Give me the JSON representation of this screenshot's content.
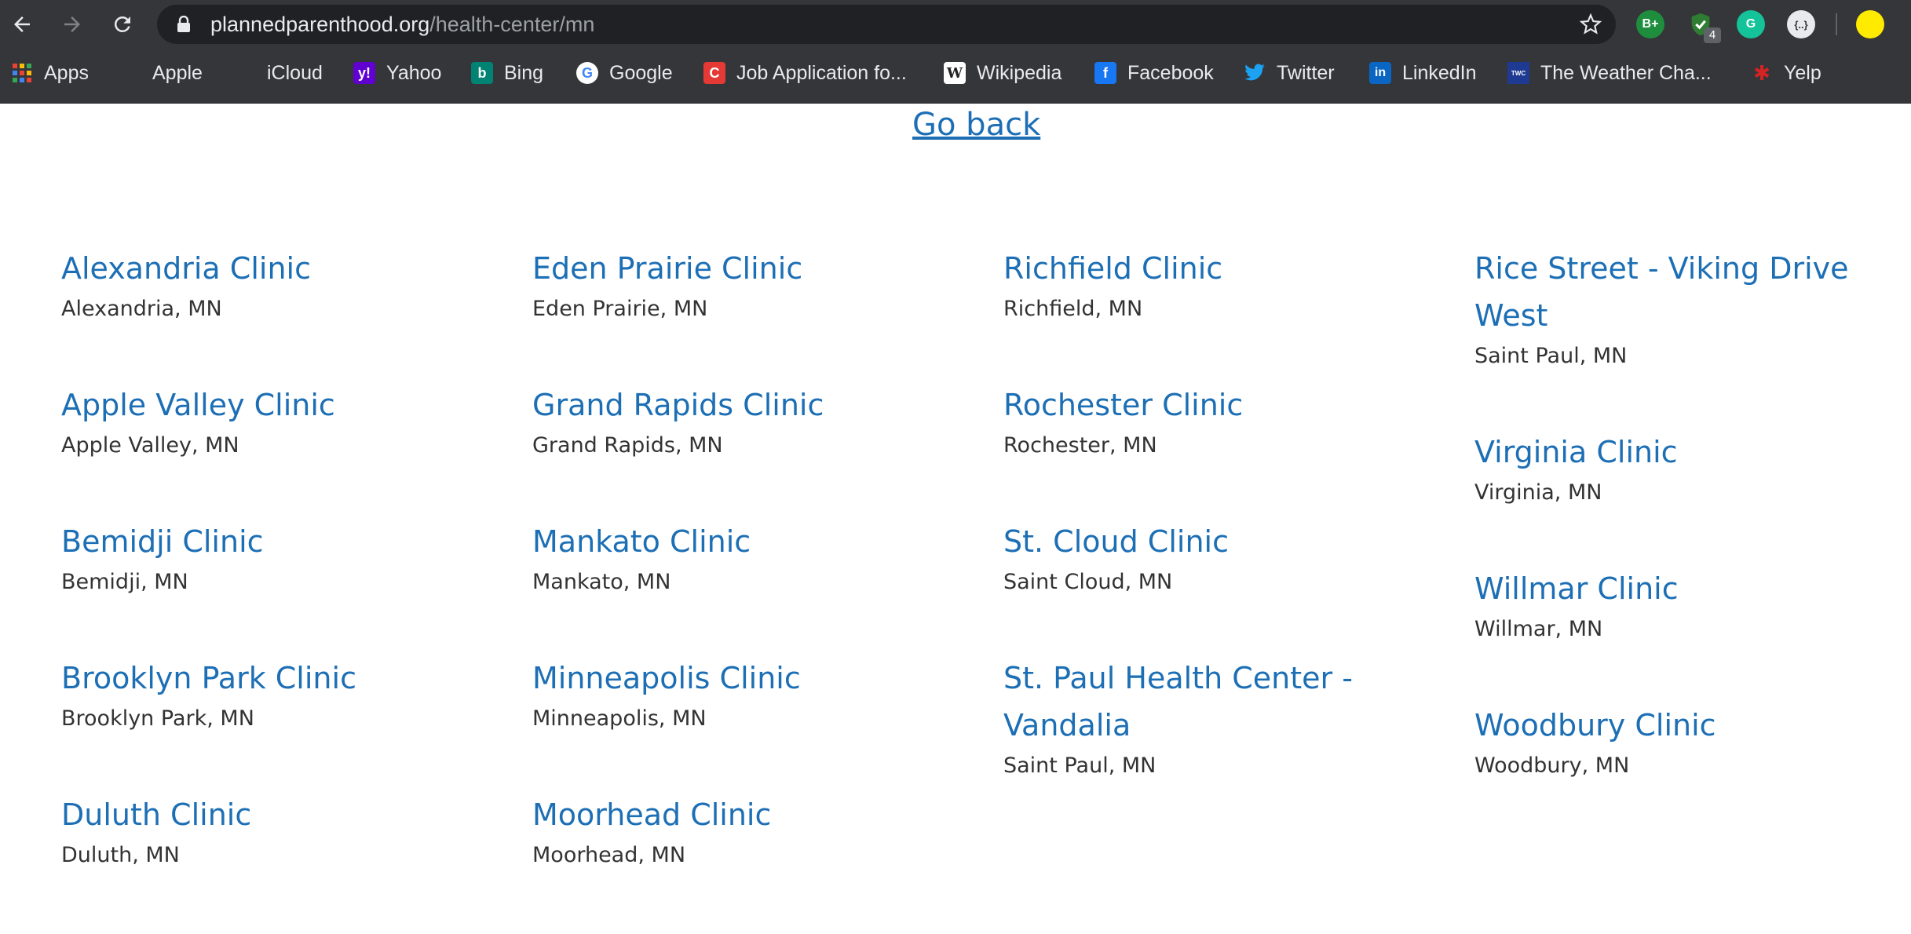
{
  "browser": {
    "url_domain": "plannedparenthood.org",
    "url_path": "/health-center/mn",
    "extension_badge": "4",
    "extensions": [
      {
        "name": "bplus-extension-icon",
        "label": "B+",
        "color": "#1e8e3e"
      },
      {
        "name": "shield-check-extension-icon",
        "label": "✓",
        "color": "#2e7d32"
      },
      {
        "name": "grammarly-extension-icon",
        "label": "G",
        "color": "#15c39a"
      },
      {
        "name": "json-extension-icon",
        "label": "{..}",
        "color": "#e8eaed"
      }
    ],
    "profile_color": "#ffeb00"
  },
  "bookmarks": [
    {
      "label": "Apps",
      "icon": "apps-grid-icon",
      "color": "#ea4335"
    },
    {
      "label": "Apple",
      "icon": "apple-icon",
      "color": "#9aa0a6"
    },
    {
      "label": "iCloud",
      "icon": "apple-icon",
      "color": "#9aa0a6"
    },
    {
      "label": "Yahoo",
      "icon": "yahoo-icon",
      "color": "#6001d2"
    },
    {
      "label": "Bing",
      "icon": "bing-icon",
      "color": "#008373"
    },
    {
      "label": "Google",
      "icon": "google-icon",
      "color": "#ffffff"
    },
    {
      "label": "Job Application fo...",
      "icon": "job-application-icon",
      "color": "#e53935"
    },
    {
      "label": "Wikipedia",
      "icon": "wikipedia-icon",
      "color": "#ffffff"
    },
    {
      "label": "Facebook",
      "icon": "facebook-icon",
      "color": "#1877f2"
    },
    {
      "label": "Twitter",
      "icon": "twitter-icon",
      "color": "#1da1f2"
    },
    {
      "label": "LinkedIn",
      "icon": "linkedin-icon",
      "color": "#0a66c2"
    },
    {
      "label": "The Weather Cha...",
      "icon": "weather-channel-icon",
      "color": "#1f3a93"
    },
    {
      "label": "Yelp",
      "icon": "yelp-icon",
      "color": "#d32323"
    }
  ],
  "page": {
    "go_back": "Go back",
    "link_color": "#1d6fb5",
    "columns": [
      [
        {
          "name": "Alexandria Clinic",
          "city": "Alexandria, MN"
        },
        {
          "name": "Apple Valley Clinic",
          "city": "Apple Valley, MN"
        },
        {
          "name": "Bemidji Clinic",
          "city": "Bemidji, MN"
        },
        {
          "name": "Brooklyn Park Clinic",
          "city": "Brooklyn Park, MN"
        },
        {
          "name": "Duluth Clinic",
          "city": "Duluth, MN"
        }
      ],
      [
        {
          "name": "Eden Prairie Clinic",
          "city": "Eden Prairie, MN"
        },
        {
          "name": "Grand Rapids Clinic",
          "city": "Grand Rapids, MN"
        },
        {
          "name": "Mankato Clinic",
          "city": "Mankato, MN"
        },
        {
          "name": "Minneapolis Clinic",
          "city": "Minneapolis, MN"
        },
        {
          "name": "Moorhead Clinic",
          "city": "Moorhead, MN"
        }
      ],
      [
        {
          "name": "Richfield Clinic",
          "city": "Richfield, MN"
        },
        {
          "name": "Rochester Clinic",
          "city": "Rochester, MN"
        },
        {
          "name": "St. Cloud Clinic",
          "city": "Saint Cloud, MN"
        },
        {
          "name": "St. Paul Health Center - Vandalia",
          "city": "Saint Paul, MN"
        }
      ],
      [
        {
          "name": "Rice Street - Viking Drive West",
          "city": "Saint Paul, MN"
        },
        {
          "name": "Virginia Clinic",
          "city": "Virginia, MN"
        },
        {
          "name": "Willmar Clinic",
          "city": "Willmar, MN"
        },
        {
          "name": "Woodbury Clinic",
          "city": "Woodbury, MN"
        }
      ]
    ]
  }
}
